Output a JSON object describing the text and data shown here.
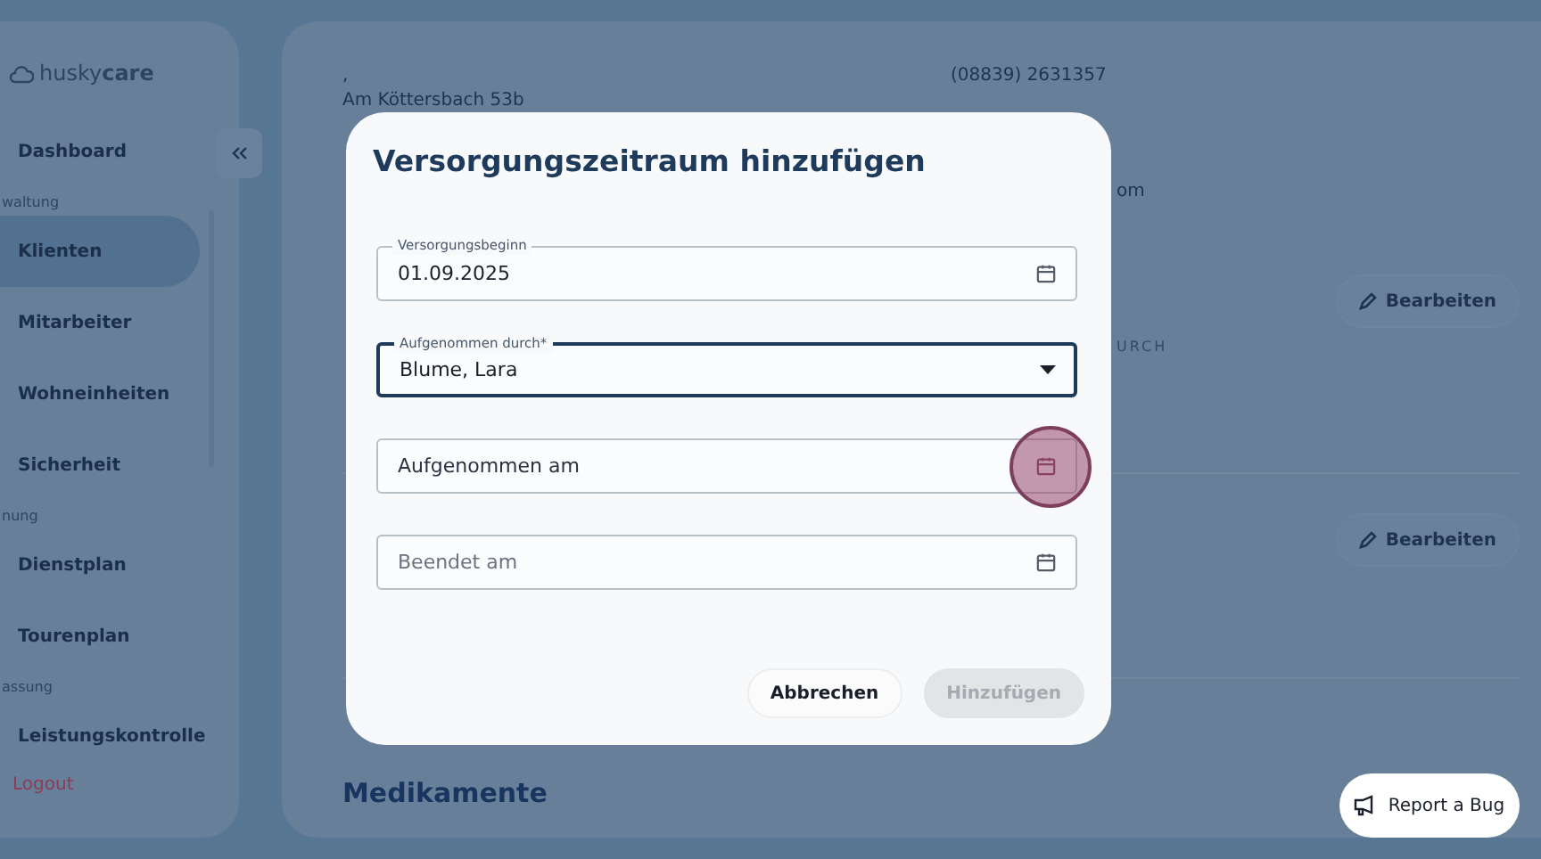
{
  "sidebar": {
    "logo": {
      "prefix": "husky",
      "suffix": "care"
    },
    "items": [
      {
        "kind": "item",
        "label": "Dashboard",
        "selected": false
      },
      {
        "kind": "section",
        "label": "waltung"
      },
      {
        "kind": "item",
        "label": "Klienten",
        "selected": true
      },
      {
        "kind": "item",
        "label": "Mitarbeiter",
        "selected": false
      },
      {
        "kind": "item",
        "label": "Wohneinheiten",
        "selected": false
      },
      {
        "kind": "item",
        "label": "Sicherheit",
        "selected": false
      },
      {
        "kind": "section",
        "label": "nung"
      },
      {
        "kind": "item",
        "label": "Dienstplan",
        "selected": false
      },
      {
        "kind": "item",
        "label": "Tourenplan",
        "selected": false
      },
      {
        "kind": "section",
        "label": "assung"
      },
      {
        "kind": "item",
        "label": "Leistungskontrolle",
        "selected": false
      }
    ],
    "logout": "Logout"
  },
  "content": {
    "comma": ",",
    "street": "Am Köttersbach 53b",
    "phone": "(08839) 2631357",
    "email_tail": "om",
    "column_tail": "URCH",
    "edit_buttons": [
      "Bearbeiten",
      "Bearbeiten"
    ],
    "section_title": "Medikamente"
  },
  "dialog": {
    "title": "Versorgungszeitraum hinzufügen",
    "fields": [
      {
        "kind": "date",
        "label": "Versorgungsbeginn",
        "value": "01.09.2025",
        "pressed": false
      },
      {
        "kind": "select",
        "label": "Aufgenommen durch*",
        "value": "Blume, Lara",
        "focused": true
      },
      {
        "kind": "date",
        "placeholder": "Aufgenommen am",
        "pressed": true
      },
      {
        "kind": "date",
        "placeholder": "Beendet am",
        "pressed": false
      }
    ],
    "buttons": [
      {
        "label": "Abbrechen",
        "disabled": false
      },
      {
        "label": "Hinzufügen",
        "disabled": true
      }
    ]
  },
  "report_button": "Report a Bug"
}
